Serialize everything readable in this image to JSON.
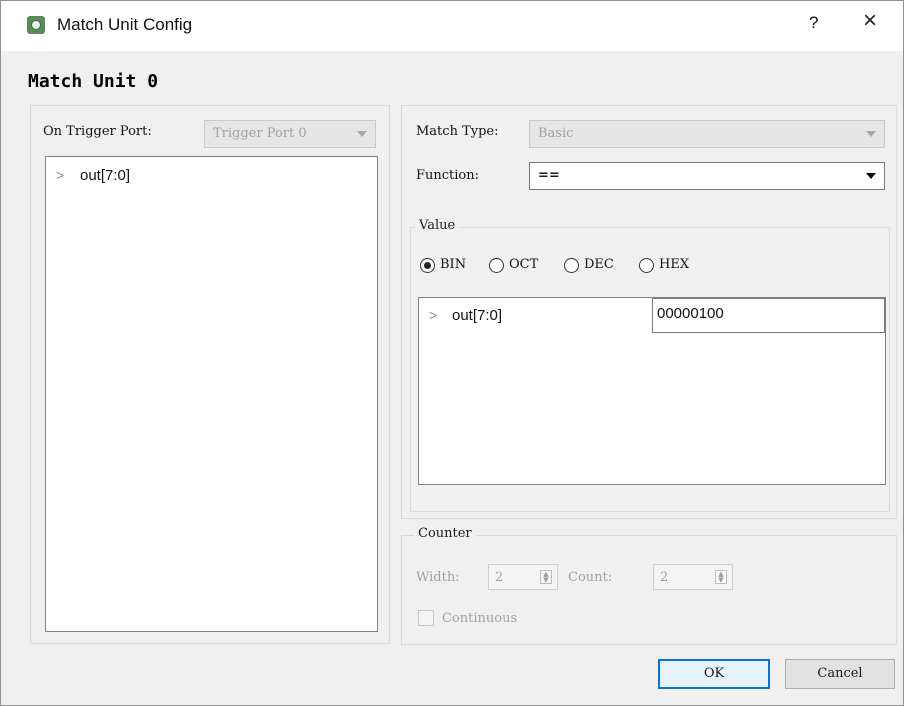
{
  "window": {
    "title": "Match Unit Config",
    "help_label": "?",
    "close_label": "×"
  },
  "unit_title": "Match Unit 0",
  "left_panel": {
    "trigger_port_label": "On Trigger Port:",
    "trigger_port_value": "Trigger Port 0",
    "tree_items": [
      {
        "label": "out[7:0]",
        "expander": ">"
      }
    ]
  },
  "match": {
    "type_label": "Match Type:",
    "type_value": "Basic",
    "function_label": "Function:",
    "function_value": "=="
  },
  "value_group": {
    "legend": "Value",
    "radix_options": [
      "BIN",
      "OCT",
      "DEC",
      "HEX"
    ],
    "selected_radix": "BIN",
    "rows": [
      {
        "label": "out[7:0]",
        "expander": ">",
        "value": "00000100"
      }
    ]
  },
  "counter_group": {
    "legend": "Counter",
    "width_label": "Width:",
    "width_value": "2",
    "count_label": "Count:",
    "count_value": "2",
    "continuous_label": "Continuous"
  },
  "buttons": {
    "ok": "OK",
    "cancel": "Cancel"
  },
  "colors": {
    "accent": "#0a73d1",
    "window_bg": "#f0f0f0"
  }
}
